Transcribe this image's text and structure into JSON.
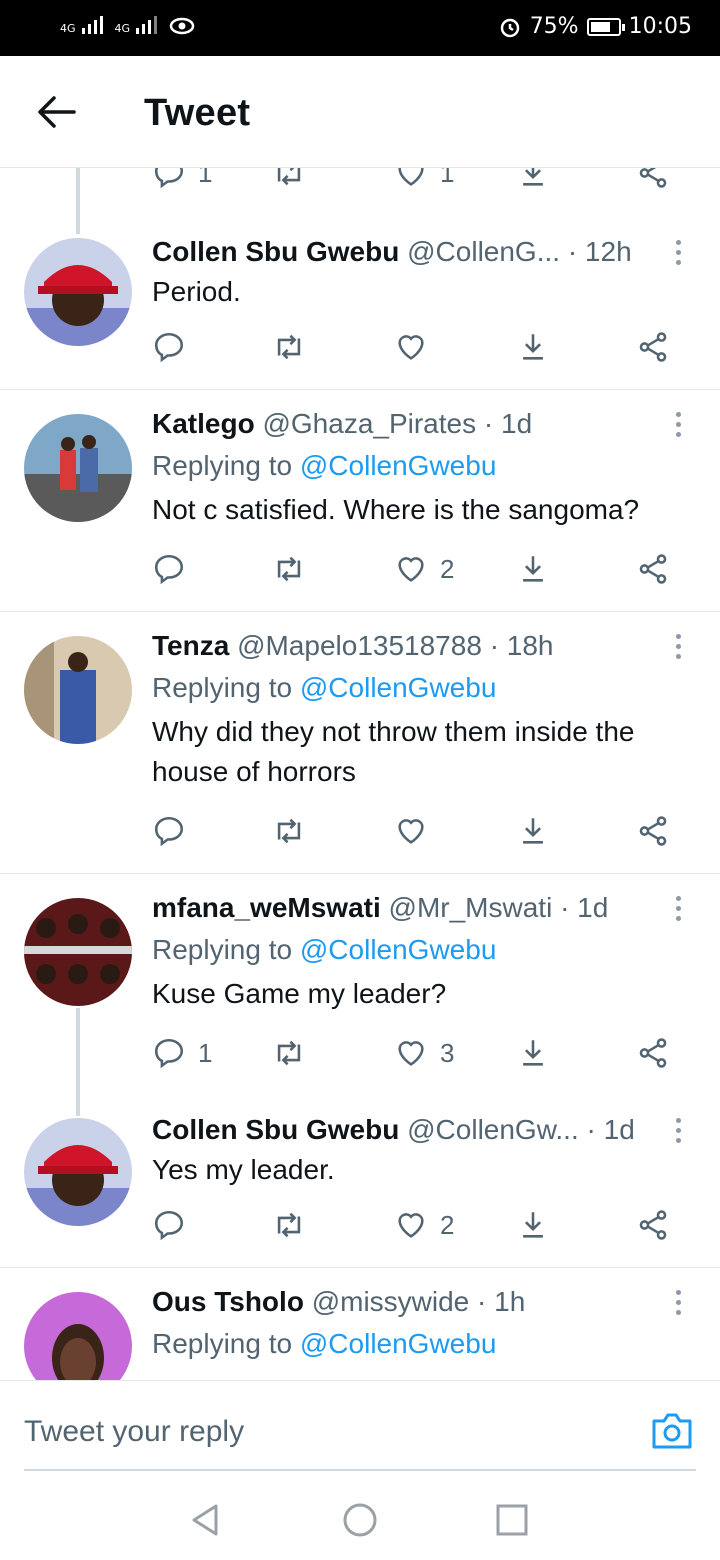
{
  "status_bar": {
    "network1": "4G",
    "network2": "4G",
    "alarm_icon": "alarm-clock-icon",
    "battery_percent": "75%",
    "battery_level": 0.75,
    "time": "10:05"
  },
  "header": {
    "back_icon": "arrow-left-icon",
    "title": "Tweet"
  },
  "partial_tweet": {
    "reply_count": "1",
    "like_count": "1"
  },
  "tweets": [
    {
      "name": "Collen Sbu Gwebu",
      "handle": "@CollenG...",
      "time": "· 12h",
      "replying_label": "",
      "replying_to": "",
      "text": "Period.",
      "reply_count": "",
      "like_count": ""
    },
    {
      "name": "Katlego",
      "handle": "@Ghaza_Pirates",
      "time": "· 1d",
      "replying_label": "Replying to",
      "replying_to": "@CollenGwebu",
      "text": "Not c satisfied.  Where is the sangoma?",
      "reply_count": "",
      "like_count": "2"
    },
    {
      "name": "Tenza",
      "handle": "@Mapelo13518788",
      "time": "· 18h",
      "replying_label": "Replying to",
      "replying_to": "@CollenGwebu",
      "text": "Why did they not throw them inside the house of horrors",
      "reply_count": "",
      "like_count": ""
    },
    {
      "name": "mfana_weMswati",
      "handle": "@Mr_Mswati",
      "time": "· 1d",
      "replying_label": "Replying to",
      "replying_to": "@CollenGwebu",
      "text": "Kuse Game my leader?",
      "reply_count": "1",
      "like_count": "3"
    },
    {
      "name": "Collen Sbu Gwebu",
      "handle": "@CollenGw...",
      "time": "· 1d",
      "replying_label": "",
      "replying_to": "",
      "text": "Yes my leader.",
      "reply_count": "",
      "like_count": "2"
    },
    {
      "name": "Ous Tsholo",
      "handle": "@missywide",
      "time": "· 1h",
      "replying_label": "Replying to",
      "replying_to": "@CollenGwebu",
      "text": "",
      "reply_count": "",
      "like_count": ""
    }
  ],
  "composer": {
    "placeholder": "Tweet your reply",
    "camera_icon": "camera-icon"
  },
  "nav": {
    "back": "triangle-back-icon",
    "home": "circle-home-icon",
    "recents": "square-recents-icon"
  },
  "colors": {
    "accent": "#1d9bf0",
    "secondary_text": "#536471",
    "divider": "#e5e8eb"
  }
}
